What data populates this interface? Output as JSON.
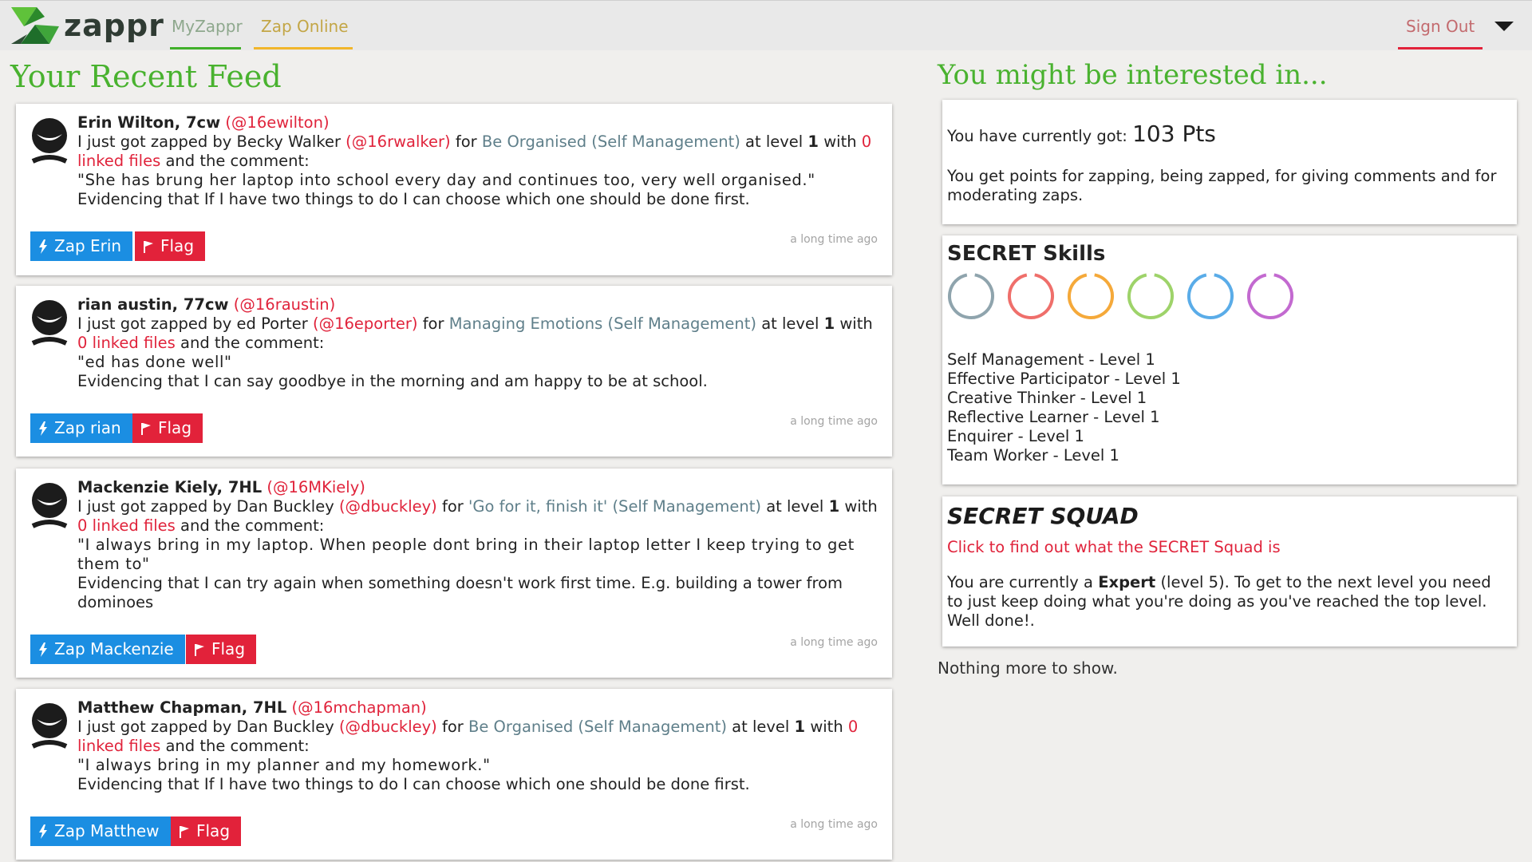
{
  "app": {
    "logo_text": "zappr"
  },
  "nav": {
    "myzappr": "MyZappr",
    "zap_online": "Zap Online",
    "sign_out": "Sign Out"
  },
  "feed": {
    "title": "Your Recent Feed",
    "items": [
      {
        "author": "Erin Wilton, 7cw",
        "handle": "(@16ewilton)",
        "zapper_text_1": "I just got zapped by Becky Walker",
        "zapper_handle": "(@16rwalker)",
        "for_text": "for",
        "skill": "Be Organised (Self Management)",
        "at_level_text": "at level",
        "level": "1",
        "with_text": "with",
        "linked_files": "0 linked files",
        "comment_intro": "and the comment:",
        "quote": "\"She has brung her laptop into school every day and continues too, very well organised.\"",
        "evidence": "Evidencing that If I have two things to do I can choose which one should be done first.",
        "zap_button": "Zap Erin",
        "flag_button": "Flag",
        "time": "a long time ago"
      },
      {
        "author": "rian austin, 77cw",
        "handle": "(@16raustin)",
        "zapper_text_1": "I just got zapped by ed Porter",
        "zapper_handle": "(@16eporter)",
        "for_text": "for",
        "skill": "Managing Emotions (Self Management)",
        "at_level_text": "at level",
        "level": "1",
        "with_text": "with",
        "linked_files": "0 linked files",
        "comment_intro": "and the comment:",
        "quote": "\"ed has done well\"",
        "evidence": "Evidencing that I can say goodbye in the morning and am happy to be at school.",
        "zap_button": "Zap rian",
        "flag_button": "Flag",
        "time": "a long time ago"
      },
      {
        "author": "Mackenzie Kiely, 7HL",
        "handle": "(@16MKiely)",
        "zapper_text_1": "I just got zapped by Dan Buckley",
        "zapper_handle": "(@dbuckley)",
        "for_text": "for",
        "skill": "'Go for it, finish it' (Self Management)",
        "at_level_text": "at level",
        "level": "1",
        "with_text": "with",
        "linked_files": "0 linked files",
        "comment_intro": "and the comment:",
        "quote": "\"I always bring in my laptop. When people dont bring in their laptop letter I keep trying to get them to\"",
        "evidence": "Evidencing that I can try again when something doesn't work first time. E.g. building a tower from dominoes",
        "zap_button": "Zap Mackenzie",
        "flag_button": "Flag",
        "time": "a long time ago"
      },
      {
        "author": "Matthew Chapman, 7HL",
        "handle": "(@16mchapman)",
        "zapper_text_1": "I just got zapped by Dan Buckley",
        "zapper_handle": "(@dbuckley)",
        "for_text": "for",
        "skill": "Be Organised (Self Management)",
        "at_level_text": "at level",
        "level": "1",
        "with_text": "with",
        "linked_files": "0 linked files",
        "comment_intro": "and the comment:",
        "quote": "\"I always bring in my planner and my homework.\"",
        "evidence": "Evidencing that If I have two things to do I can choose which one should be done first.",
        "zap_button": "Zap Matthew",
        "flag_button": "Flag",
        "time": "a long time ago"
      }
    ]
  },
  "sidebar": {
    "title": "You might be interested in...",
    "points": {
      "label": "You have currently got:",
      "value": "103 Pts",
      "description": "You get points for zapping, being zapped, for giving comments and for moderating zaps."
    },
    "skills": {
      "title": "SECRET Skills",
      "rings": [
        {
          "name": "self-management",
          "color": "#8fa4ad"
        },
        {
          "name": "effective-participator",
          "color": "#ef6f6b"
        },
        {
          "name": "creative-thinker",
          "color": "#f5a93a"
        },
        {
          "name": "reflective-learner",
          "color": "#9ed36a"
        },
        {
          "name": "enquirer",
          "color": "#5aace8"
        },
        {
          "name": "team-worker",
          "color": "#c36ad0"
        }
      ],
      "list": [
        "Self Management - Level 1",
        "Effective Participator - Level 1",
        "Creative Thinker - Level 1",
        "Reflective Learner - Level 1",
        "Enquirer - Level 1",
        "Team Worker - Level 1"
      ]
    },
    "squad": {
      "title": "SECRET SQUAD",
      "link": "Click to find out what the SECRET Squad is",
      "desc_prefix": "You are currently a",
      "rank": "Expert",
      "desc_suffix": "(level 5). To get to the next level you need to just keep doing what you're doing as you've reached the top level. Well done!."
    },
    "nothing_more": "Nothing more to show."
  },
  "colors": {
    "brand_green": "#49b22f",
    "zap_blue": "#1b8ee2",
    "flag_red": "#e2223a",
    "link_red": "#e0233b"
  }
}
